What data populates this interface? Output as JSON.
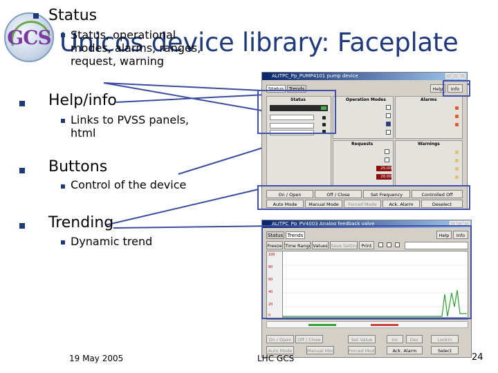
{
  "slide": {
    "title": "Unicos device library: Faceplate",
    "footer_date": "19 May 2005",
    "footer_center": "LHC GCS",
    "page_number": "24",
    "logo_text": "GCS"
  },
  "bullets": [
    {
      "label": "Status",
      "subs": [
        "Status, operational modes, alarms, ranges, request, warning"
      ]
    },
    {
      "label": "Help/info",
      "subs": [
        "Links to PVSS panels, html"
      ]
    },
    {
      "label": "Buttons",
      "subs": [
        "Control of the device"
      ]
    },
    {
      "label": "Trending",
      "subs": [
        "Dynamic trend"
      ]
    }
  ],
  "faceplate1": {
    "window_title": "ALITPC_Pp_PUMP4101 pump device",
    "tabs": [
      "Status",
      "Trends"
    ],
    "help_buttons": [
      "Help",
      "Info"
    ],
    "sections": {
      "status": "Status",
      "modes": "Operation Modes",
      "alarms": "Alarms",
      "requests": "Requests",
      "warnings": "Warnings"
    },
    "request_values": [
      "25.00",
      "20.00"
    ],
    "command_buttons_row1": [
      "On / Open",
      "Off / Close",
      "Set Frequency",
      "Controlled Off"
    ],
    "command_buttons_row2": [
      "Auto Mode",
      "Manual Mode",
      "Forced Mode",
      "Ack. Alarm",
      "Deselect"
    ]
  },
  "faceplate2": {
    "window_title": "ALITPC_Pp_PV4003 Analog feedback valve",
    "tabs": [
      "Status",
      "Trends"
    ],
    "help_buttons": [
      "Help",
      "Info"
    ],
    "toolbar": [
      "Freeze",
      "Time Range",
      "Values",
      "Save Setting",
      "Print"
    ],
    "y_ticks": [
      "100",
      "80",
      "60",
      "40",
      "20",
      "0"
    ],
    "command_buttons": [
      "On / Open",
      "Off / Close",
      "Set Value",
      "Inc",
      "Dec",
      "Lockin",
      "Auto Mode",
      "Manual Mode",
      "Forced Mode",
      "Ack. Alarm",
      "Select"
    ]
  },
  "colors": {
    "title": "#1f3a7a",
    "outline": "#4050a8",
    "connector": "#3a4aa0"
  }
}
